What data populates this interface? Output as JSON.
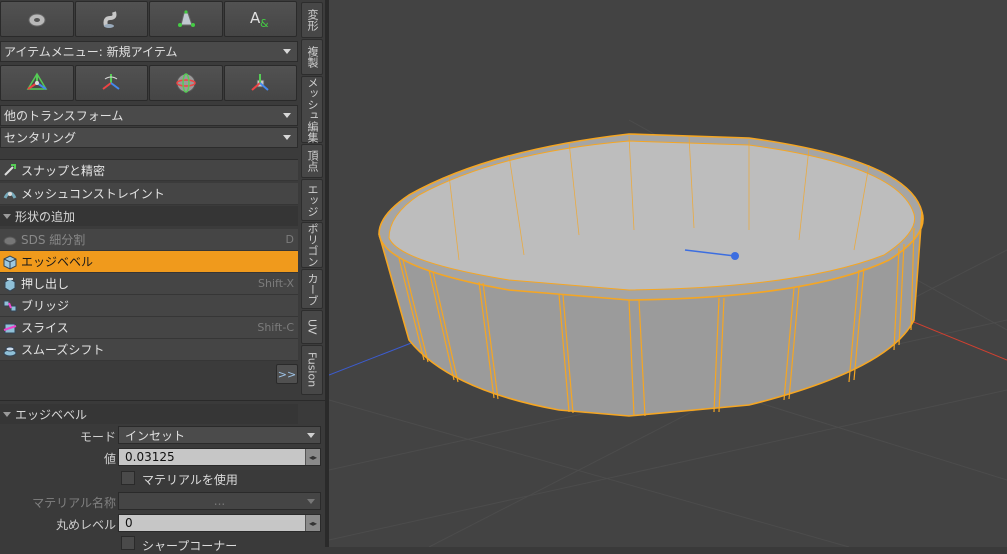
{
  "tabs": [
    "変形",
    "複製",
    "メッシュ編集",
    "頂点",
    "エッジ",
    "ポリゴン",
    "カーブ",
    "UV",
    "Fusion"
  ],
  "toolbar_top": {
    "icons": [
      "torus-icon",
      "twist-icon",
      "bell-icon",
      "text-icon"
    ]
  },
  "item_menu": {
    "value": "アイテムメニュー: 新規アイテム"
  },
  "toolbar_transform": {
    "icons": [
      "move-gizmo-icon",
      "rotate-gizmo-icon",
      "sphere-gizmo-icon",
      "scale-gizmo-icon"
    ]
  },
  "other_transform": {
    "value": "他のトランスフォーム"
  },
  "centering": {
    "value": "センタリング"
  },
  "snap": {
    "label": "スナップと精密"
  },
  "mesh_constraint": {
    "label": "メッシュコンストレイント"
  },
  "shape_add": {
    "label": "形状の追加"
  },
  "commands": [
    {
      "label": "SDS 細分割",
      "shortcut": "D"
    },
    {
      "label": "エッジベベル",
      "shortcut": ""
    },
    {
      "label": "押し出し",
      "shortcut": "Shift-X"
    },
    {
      "label": "ブリッジ",
      "shortcut": ""
    },
    {
      "label": "スライス",
      "shortcut": "Shift-C"
    },
    {
      "label": "スムーズシフト",
      "shortcut": ""
    }
  ],
  "more_button": ">>",
  "properties": {
    "title": "エッジベベル",
    "mode_label": "モード",
    "mode_value": "インセット",
    "value_label": "値",
    "value_value": "0.03125",
    "use_material_label": "マテリアルを使用",
    "material_name_label": "マテリアル名称",
    "material_name_value": "...",
    "round_level_label": "丸めレベル",
    "round_level_value": "0",
    "sharp_corner_label": "シャープコーナー"
  },
  "colors": {
    "accent": "#f09a1c",
    "panel": "#3b3b3b",
    "viewport": "#434343",
    "wire": "#f5a623"
  }
}
